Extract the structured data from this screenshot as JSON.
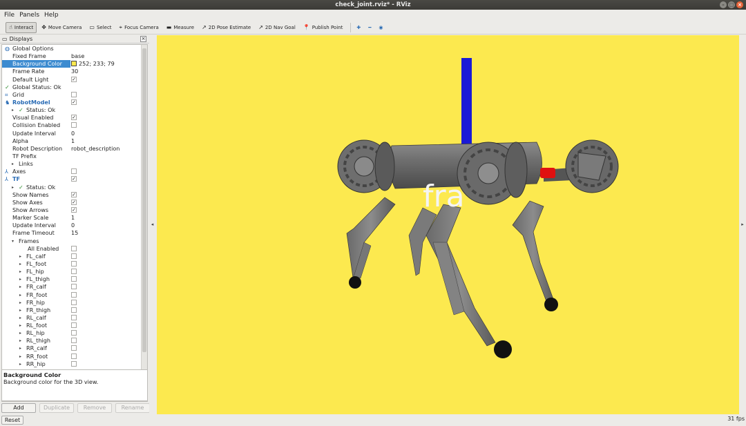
{
  "window": {
    "title": "check_joint.rviz* - RViz"
  },
  "menu": [
    "File",
    "Panels",
    "Help"
  ],
  "toolbar": {
    "tools": [
      {
        "label": "Interact",
        "icon": "hand-icon",
        "glyph": "☝",
        "active": true
      },
      {
        "label": "Move Camera",
        "icon": "move-camera-icon",
        "glyph": "✥",
        "active": false
      },
      {
        "label": "Select",
        "icon": "select-icon",
        "glyph": "▭",
        "active": false
      },
      {
        "label": "Focus Camera",
        "icon": "focus-camera-icon",
        "glyph": "⌖",
        "active": false
      },
      {
        "label": "Measure",
        "icon": "measure-icon",
        "glyph": "▬",
        "active": false
      },
      {
        "label": "2D Pose Estimate",
        "icon": "pose-estimate-icon",
        "glyph": "↗",
        "active": false
      },
      {
        "label": "2D Nav Goal",
        "icon": "nav-goal-icon",
        "glyph": "↗",
        "active": false
      },
      {
        "label": "Publish Point",
        "icon": "publish-point-icon",
        "glyph": "📍",
        "active": false
      }
    ]
  },
  "displays": {
    "header": "Displays",
    "rows": [
      {
        "label": "Global Options",
        "indent": 0,
        "icon": "◍",
        "arrow": "",
        "value": ""
      },
      {
        "label": "Fixed Frame",
        "indent": 1,
        "value": "base"
      },
      {
        "label": "Background Color",
        "indent": 1,
        "value": "252; 233; 79",
        "swatch": "#fce94f",
        "selected": true
      },
      {
        "label": "Frame Rate",
        "indent": 1,
        "value": "30"
      },
      {
        "label": "Default Light",
        "indent": 1,
        "check": true
      },
      {
        "label": "Global Status: Ok",
        "indent": 0,
        "icon": "✓",
        "iconClass": "green"
      },
      {
        "label": "Grid",
        "indent": 0,
        "icon": "⌗",
        "check": false
      },
      {
        "label": "RobotModel",
        "indent": 0,
        "icon": "♞",
        "check": true,
        "bold": true
      },
      {
        "label": "Status: Ok",
        "indent": 1,
        "icon": "✓",
        "iconClass": "green",
        "arrow": "▸"
      },
      {
        "label": "Visual Enabled",
        "indent": 1,
        "check": true
      },
      {
        "label": "Collision Enabled",
        "indent": 1,
        "check": false
      },
      {
        "label": "Update Interval",
        "indent": 1,
        "value": "0"
      },
      {
        "label": "Alpha",
        "indent": 1,
        "value": "1"
      },
      {
        "label": "Robot Description",
        "indent": 1,
        "value": "robot_description"
      },
      {
        "label": "TF Prefix",
        "indent": 1,
        "value": ""
      },
      {
        "label": "Links",
        "indent": 1,
        "arrow": "▸"
      },
      {
        "label": "Axes",
        "indent": 0,
        "icon": "⅄",
        "check": false
      },
      {
        "label": "TF",
        "indent": 0,
        "icon": "⅄",
        "check": true,
        "bold": true
      },
      {
        "label": "Status: Ok",
        "indent": 1,
        "icon": "✓",
        "iconClass": "green",
        "arrow": "▸"
      },
      {
        "label": "Show Names",
        "indent": 1,
        "check": true
      },
      {
        "label": "Show Axes",
        "indent": 1,
        "check": true
      },
      {
        "label": "Show Arrows",
        "indent": 1,
        "check": true
      },
      {
        "label": "Marker Scale",
        "indent": 1,
        "value": "1"
      },
      {
        "label": "Update Interval",
        "indent": 1,
        "value": "0"
      },
      {
        "label": "Frame Timeout",
        "indent": 1,
        "value": "15"
      },
      {
        "label": "Frames",
        "indent": 1,
        "arrow": "▾"
      },
      {
        "label": "All Enabled",
        "indent": 3,
        "check": false
      },
      {
        "label": "FL_calf",
        "indent": 2,
        "arrow": "▸",
        "check": false
      },
      {
        "label": "FL_foot",
        "indent": 2,
        "arrow": "▸",
        "check": false
      },
      {
        "label": "FL_hip",
        "indent": 2,
        "arrow": "▸",
        "check": false
      },
      {
        "label": "FL_thigh",
        "indent": 2,
        "arrow": "▸",
        "check": false
      },
      {
        "label": "FR_calf",
        "indent": 2,
        "arrow": "▸",
        "check": false
      },
      {
        "label": "FR_foot",
        "indent": 2,
        "arrow": "▸",
        "check": false
      },
      {
        "label": "FR_hip",
        "indent": 2,
        "arrow": "▸",
        "check": false
      },
      {
        "label": "FR_thigh",
        "indent": 2,
        "arrow": "▸",
        "check": false
      },
      {
        "label": "RL_calf",
        "indent": 2,
        "arrow": "▸",
        "check": false
      },
      {
        "label": "RL_foot",
        "indent": 2,
        "arrow": "▸",
        "check": false
      },
      {
        "label": "RL_hip",
        "indent": 2,
        "arrow": "▸",
        "check": false
      },
      {
        "label": "RL_thigh",
        "indent": 2,
        "arrow": "▸",
        "check": false
      },
      {
        "label": "RR_calf",
        "indent": 2,
        "arrow": "▸",
        "check": false
      },
      {
        "label": "RR_foot",
        "indent": 2,
        "arrow": "▸",
        "check": false
      },
      {
        "label": "RR_hip",
        "indent": 2,
        "arrow": "▸",
        "check": false
      }
    ],
    "description": {
      "title": "Background Color",
      "text": "Background color for the 3D view."
    },
    "buttons": [
      {
        "label": "Add",
        "disabled": false
      },
      {
        "label": "Duplicate",
        "disabled": true
      },
      {
        "label": "Remove",
        "disabled": true
      },
      {
        "label": "Rename",
        "disabled": true
      }
    ]
  },
  "viewport": {
    "background": "#fce94f",
    "overlay_text": "fra"
  },
  "status": {
    "reset_label": "Reset",
    "fps": "31 fps"
  }
}
